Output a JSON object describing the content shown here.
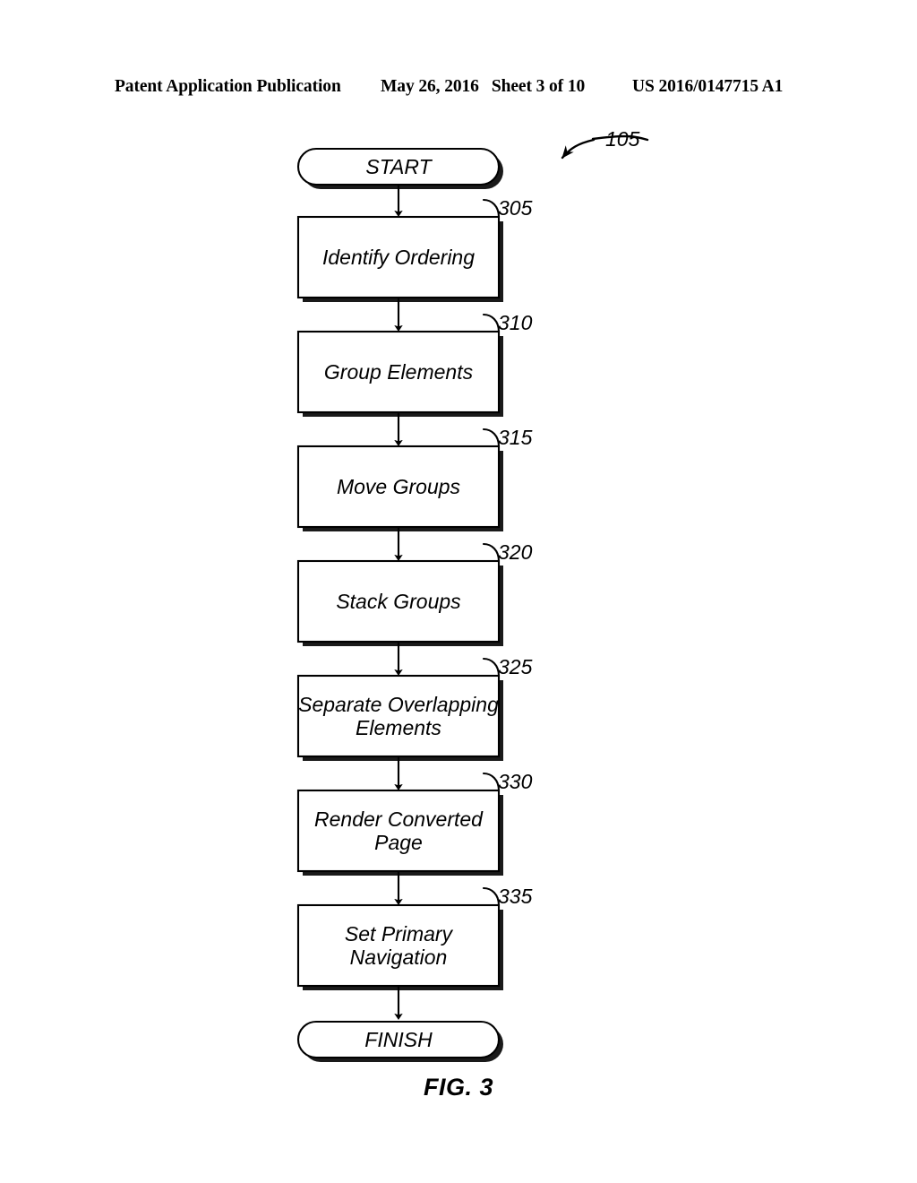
{
  "header": {
    "publication": "Patent Application Publication",
    "date": "May 26, 2016",
    "sheet": "Sheet 3 of 10",
    "patent_number": "US 2016/0147715 A1"
  },
  "figure": {
    "caption": "FIG. 3",
    "diagram_reference": "105"
  },
  "flowchart": {
    "start": {
      "label": "START"
    },
    "finish": {
      "label": "FINISH"
    },
    "steps": [
      {
        "ref": "305",
        "label": "Identify Ordering"
      },
      {
        "ref": "310",
        "label": "Group Elements"
      },
      {
        "ref": "315",
        "label": "Move Groups"
      },
      {
        "ref": "320",
        "label": "Stack Groups"
      },
      {
        "ref": "325",
        "label": "Separate Overlapping\nElements"
      },
      {
        "ref": "330",
        "label": "Render Converted\nPage"
      },
      {
        "ref": "335",
        "label": "Set Primary\nNavigation"
      }
    ]
  },
  "colors": {
    "ink": "#000000",
    "paper": "#ffffff",
    "shadow": "#222222"
  }
}
